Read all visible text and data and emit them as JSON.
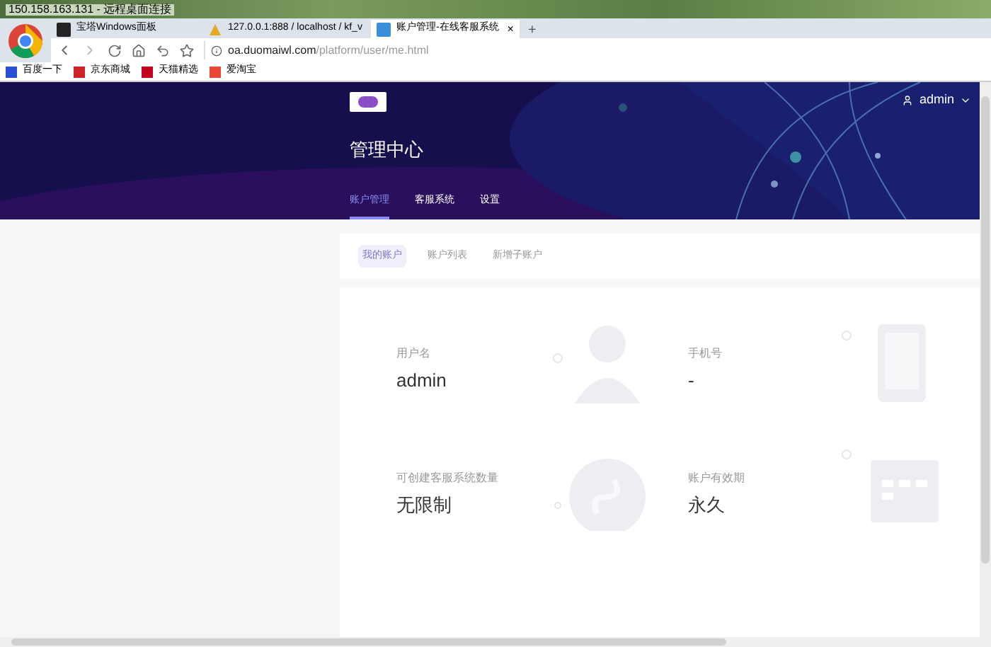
{
  "window": {
    "title": "150.158.163.131 - 远程桌面连接"
  },
  "browser_tabs": [
    {
      "title": "宝塔Windows面板",
      "selected": false,
      "kind": "panel"
    },
    {
      "title": "127.0.0.1:888 / localhost / kf_v",
      "selected": false,
      "kind": "db"
    },
    {
      "title": "账户管理-在线客服系统",
      "selected": true,
      "kind": "page"
    }
  ],
  "tab_close": "×",
  "new_tab": "+",
  "address": {
    "domain": "oa.duomaiwl.com",
    "path": "/platform/user/me.html"
  },
  "bookmarks": [
    {
      "label": "百度一下",
      "color": "#2b4fd6"
    },
    {
      "label": "京东商城",
      "color": "#d0222a"
    },
    {
      "label": "天猫精选",
      "color": "#c4001d"
    },
    {
      "label": "爱淘宝",
      "color": "#e8473a"
    }
  ],
  "header": {
    "user": "admin",
    "title": "管理中心"
  },
  "nav": [
    {
      "label": "账户管理",
      "selected": true
    },
    {
      "label": "客服系统",
      "selected": false
    },
    {
      "label": "设置",
      "selected": false
    }
  ],
  "subtabs": [
    {
      "label": "我的账户",
      "selected": true
    },
    {
      "label": "账户列表",
      "selected": false
    },
    {
      "label": "新增子账户",
      "selected": false
    }
  ],
  "info": [
    {
      "label": "用户名",
      "value": "admin",
      "kind": "user"
    },
    {
      "label": "手机号",
      "value": "-",
      "kind": "phone"
    },
    {
      "label": "可创建客服系统数量",
      "value": "无限制",
      "kind": "link"
    },
    {
      "label": "账户有效期",
      "value": "永久",
      "kind": "calendar"
    }
  ]
}
